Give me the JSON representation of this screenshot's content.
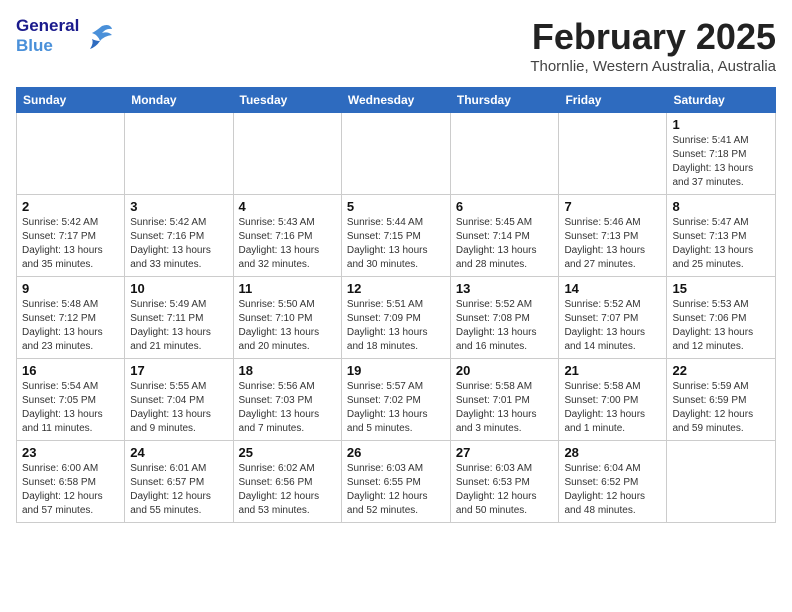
{
  "logo": {
    "line1": "General",
    "line2": "Blue"
  },
  "title": "February 2025",
  "subtitle": "Thornlie, Western Australia, Australia",
  "weekdays": [
    "Sunday",
    "Monday",
    "Tuesday",
    "Wednesday",
    "Thursday",
    "Friday",
    "Saturday"
  ],
  "weeks": [
    [
      {
        "day": "",
        "info": ""
      },
      {
        "day": "",
        "info": ""
      },
      {
        "day": "",
        "info": ""
      },
      {
        "day": "",
        "info": ""
      },
      {
        "day": "",
        "info": ""
      },
      {
        "day": "",
        "info": ""
      },
      {
        "day": "1",
        "info": "Sunrise: 5:41 AM\nSunset: 7:18 PM\nDaylight: 13 hours\nand 37 minutes."
      }
    ],
    [
      {
        "day": "2",
        "info": "Sunrise: 5:42 AM\nSunset: 7:17 PM\nDaylight: 13 hours\nand 35 minutes."
      },
      {
        "day": "3",
        "info": "Sunrise: 5:42 AM\nSunset: 7:16 PM\nDaylight: 13 hours\nand 33 minutes."
      },
      {
        "day": "4",
        "info": "Sunrise: 5:43 AM\nSunset: 7:16 PM\nDaylight: 13 hours\nand 32 minutes."
      },
      {
        "day": "5",
        "info": "Sunrise: 5:44 AM\nSunset: 7:15 PM\nDaylight: 13 hours\nand 30 minutes."
      },
      {
        "day": "6",
        "info": "Sunrise: 5:45 AM\nSunset: 7:14 PM\nDaylight: 13 hours\nand 28 minutes."
      },
      {
        "day": "7",
        "info": "Sunrise: 5:46 AM\nSunset: 7:13 PM\nDaylight: 13 hours\nand 27 minutes."
      },
      {
        "day": "8",
        "info": "Sunrise: 5:47 AM\nSunset: 7:13 PM\nDaylight: 13 hours\nand 25 minutes."
      }
    ],
    [
      {
        "day": "9",
        "info": "Sunrise: 5:48 AM\nSunset: 7:12 PM\nDaylight: 13 hours\nand 23 minutes."
      },
      {
        "day": "10",
        "info": "Sunrise: 5:49 AM\nSunset: 7:11 PM\nDaylight: 13 hours\nand 21 minutes."
      },
      {
        "day": "11",
        "info": "Sunrise: 5:50 AM\nSunset: 7:10 PM\nDaylight: 13 hours\nand 20 minutes."
      },
      {
        "day": "12",
        "info": "Sunrise: 5:51 AM\nSunset: 7:09 PM\nDaylight: 13 hours\nand 18 minutes."
      },
      {
        "day": "13",
        "info": "Sunrise: 5:52 AM\nSunset: 7:08 PM\nDaylight: 13 hours\nand 16 minutes."
      },
      {
        "day": "14",
        "info": "Sunrise: 5:52 AM\nSunset: 7:07 PM\nDaylight: 13 hours\nand 14 minutes."
      },
      {
        "day": "15",
        "info": "Sunrise: 5:53 AM\nSunset: 7:06 PM\nDaylight: 13 hours\nand 12 minutes."
      }
    ],
    [
      {
        "day": "16",
        "info": "Sunrise: 5:54 AM\nSunset: 7:05 PM\nDaylight: 13 hours\nand 11 minutes."
      },
      {
        "day": "17",
        "info": "Sunrise: 5:55 AM\nSunset: 7:04 PM\nDaylight: 13 hours\nand 9 minutes."
      },
      {
        "day": "18",
        "info": "Sunrise: 5:56 AM\nSunset: 7:03 PM\nDaylight: 13 hours\nand 7 minutes."
      },
      {
        "day": "19",
        "info": "Sunrise: 5:57 AM\nSunset: 7:02 PM\nDaylight: 13 hours\nand 5 minutes."
      },
      {
        "day": "20",
        "info": "Sunrise: 5:58 AM\nSunset: 7:01 PM\nDaylight: 13 hours\nand 3 minutes."
      },
      {
        "day": "21",
        "info": "Sunrise: 5:58 AM\nSunset: 7:00 PM\nDaylight: 13 hours\nand 1 minute."
      },
      {
        "day": "22",
        "info": "Sunrise: 5:59 AM\nSunset: 6:59 PM\nDaylight: 12 hours\nand 59 minutes."
      }
    ],
    [
      {
        "day": "23",
        "info": "Sunrise: 6:00 AM\nSunset: 6:58 PM\nDaylight: 12 hours\nand 57 minutes."
      },
      {
        "day": "24",
        "info": "Sunrise: 6:01 AM\nSunset: 6:57 PM\nDaylight: 12 hours\nand 55 minutes."
      },
      {
        "day": "25",
        "info": "Sunrise: 6:02 AM\nSunset: 6:56 PM\nDaylight: 12 hours\nand 53 minutes."
      },
      {
        "day": "26",
        "info": "Sunrise: 6:03 AM\nSunset: 6:55 PM\nDaylight: 12 hours\nand 52 minutes."
      },
      {
        "day": "27",
        "info": "Sunrise: 6:03 AM\nSunset: 6:53 PM\nDaylight: 12 hours\nand 50 minutes."
      },
      {
        "day": "28",
        "info": "Sunrise: 6:04 AM\nSunset: 6:52 PM\nDaylight: 12 hours\nand 48 minutes."
      },
      {
        "day": "",
        "info": ""
      }
    ]
  ]
}
